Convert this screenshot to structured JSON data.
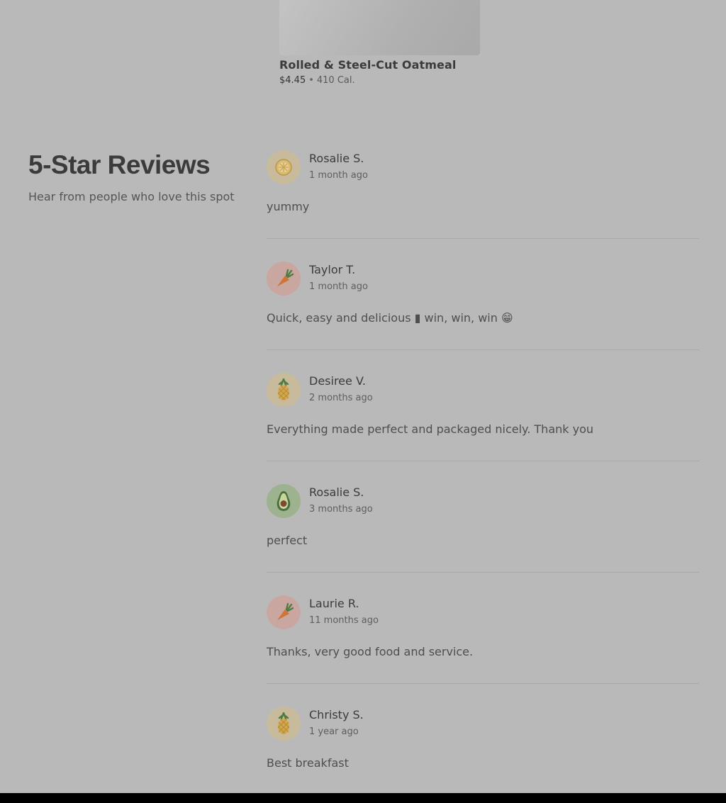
{
  "product": {
    "name": "Rolled & Steel-Cut Oatmeal",
    "price": "$4.45",
    "separator": "•",
    "calories": "410 Cal."
  },
  "reviews_section": {
    "title": "5-Star Reviews",
    "subtitle": "Hear from people who love this spot"
  },
  "reviews": [
    {
      "name": "Rosalie S.",
      "time": "1 month ago",
      "text": "yummy",
      "avatar_icon": "lemon-icon"
    },
    {
      "name": "Taylor T.",
      "time": "1 month ago",
      "text": "Quick, easy and delicious ▮ win, win, win 😁",
      "avatar_icon": "carrot-icon"
    },
    {
      "name": "Desiree V.",
      "time": "2 months ago",
      "text": "Everything made perfect and packaged nicely. Thank you",
      "avatar_icon": "pineapple-icon"
    },
    {
      "name": "Rosalie S.",
      "time": "3 months ago",
      "text": "perfect",
      "avatar_icon": "avocado-icon"
    },
    {
      "name": "Laurie R.",
      "time": "11 months ago",
      "text": "Thanks, very good food and service.",
      "avatar_icon": "carrot-icon"
    },
    {
      "name": "Christy S.",
      "time": "1 year ago",
      "text": "Best breakfast",
      "avatar_icon": "pineapple-icon"
    }
  ]
}
